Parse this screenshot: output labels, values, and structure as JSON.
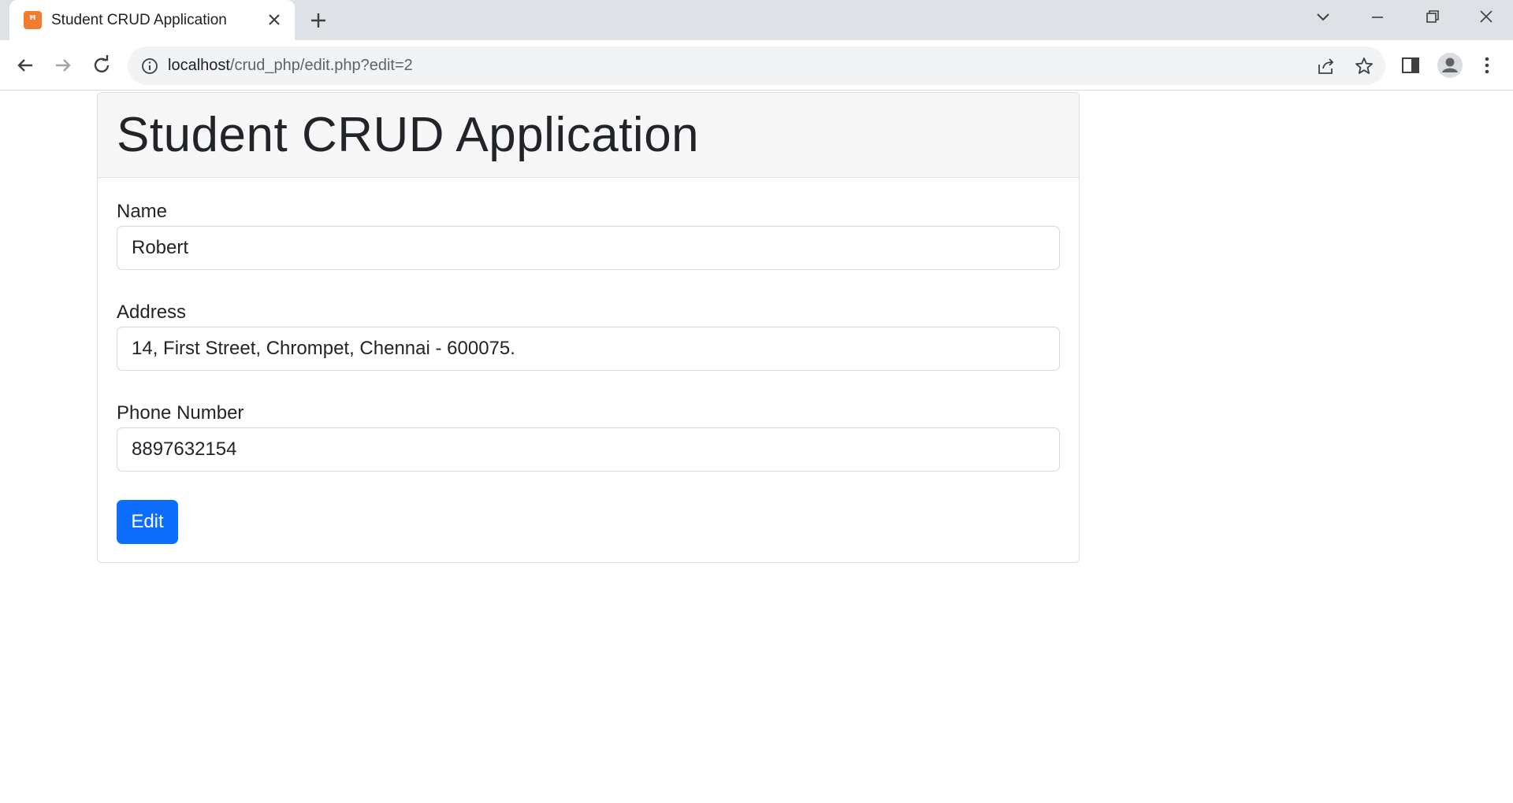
{
  "browser": {
    "tab_title": "Student CRUD Application",
    "url_host": "localhost",
    "url_path": "/crud_php/edit.php?edit=2"
  },
  "page": {
    "title": "Student CRUD Application",
    "form": {
      "name_label": "Name",
      "name_value": "Robert",
      "address_label": "Address",
      "address_value": "14, First Street, Chrompet, Chennai - 600075.",
      "phone_label": "Phone Number",
      "phone_value": "8897632154",
      "submit_label": "Edit"
    }
  },
  "colors": {
    "primary": "#0d6efd",
    "favicon": "#f07c2e"
  }
}
